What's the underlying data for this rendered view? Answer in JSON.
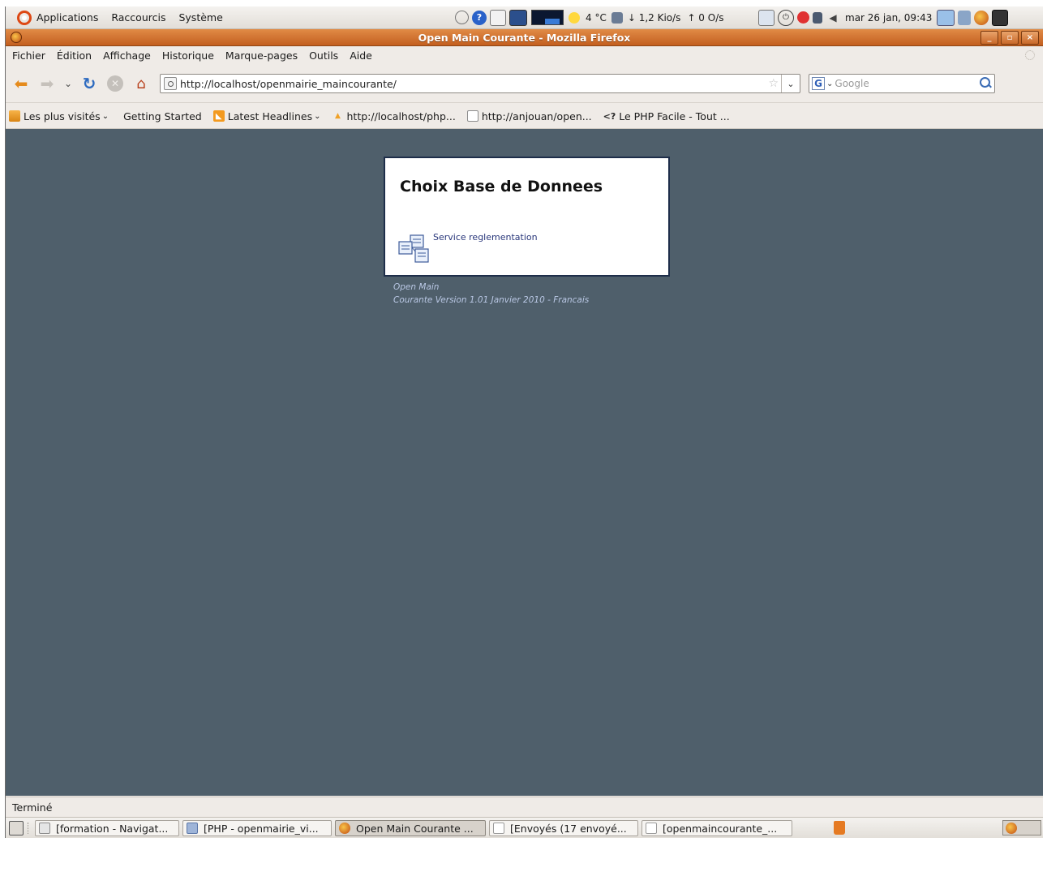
{
  "top_panel": {
    "menus": [
      "Applications",
      "Raccourcis",
      "Système"
    ],
    "weather": "4 °C",
    "net_down": "↓ 1,2 Kio/s",
    "net_up": "↑ 0 O/s",
    "clock": "mar 26 jan, 09:43"
  },
  "window": {
    "title": "Open Main Courante - Mozilla Firefox"
  },
  "menubar": {
    "items": [
      "Fichier",
      "Édition",
      "Affichage",
      "Historique",
      "Marque-pages",
      "Outils",
      "Aide"
    ]
  },
  "navbar": {
    "url": "http://localhost/openmairie_maincourante/",
    "search_placeholder": "Google",
    "search_engine_letter": "G"
  },
  "bookmarks": {
    "items": [
      {
        "label": "Les plus visités",
        "icon": "folder-icon",
        "has_menu": true
      },
      {
        "label": "Getting Started",
        "icon": "getting-started-icon",
        "has_menu": false
      },
      {
        "label": "Latest Headlines",
        "icon": "rss-icon",
        "has_menu": true
      },
      {
        "label": "http://localhost/php...",
        "icon": "phpmyadmin-icon",
        "has_menu": false
      },
      {
        "label": "http://anjouan/open...",
        "icon": "page-icon",
        "has_menu": false
      },
      {
        "label": "Le PHP Facile - Tout ...",
        "icon": "php-facile-icon",
        "has_menu": false
      }
    ],
    "php_facile_glyph": "<?"
  },
  "page": {
    "dialog_title": "Choix Base de Donnees",
    "db_link": "Service reglementation",
    "footer_line1": "Open Main",
    "footer_line2": "Courante  Version 1.01 Janvier 2010 -  Francais"
  },
  "status": {
    "text": "Terminé"
  },
  "taskbar": {
    "tasks": [
      {
        "label": "[formation - Navigat...",
        "icon": "folder-icon",
        "active": false
      },
      {
        "label": "[PHP - openmairie_vi...",
        "icon": "editor-icon",
        "active": false
      },
      {
        "label": "Open Main Courante ...",
        "icon": "firefox-icon",
        "active": true
      },
      {
        "label": "[Envoyés (17 envoyé...",
        "icon": "mail-icon",
        "active": false
      },
      {
        "label": "[openmaincourante_...",
        "icon": "document-icon",
        "active": false
      }
    ]
  },
  "colors": {
    "content_background": "#4f5f6b",
    "titlebar_orange": "#d2722e",
    "link_blue": "#28367a",
    "footer_text": "#b9c7e4"
  }
}
